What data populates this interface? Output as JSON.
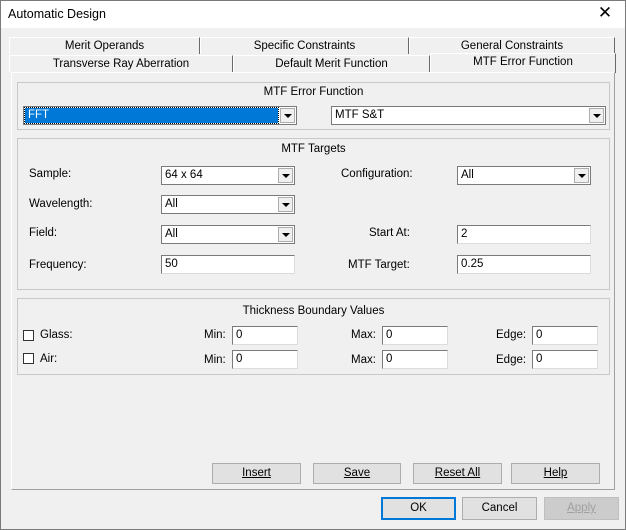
{
  "window": {
    "title": "Automatic Design"
  },
  "tabs": {
    "row1": [
      "Merit Operands",
      "Specific Constraints",
      "General Constraints"
    ],
    "row2": [
      "Transverse Ray Aberration",
      "Default Merit Function",
      "MTF Error Function"
    ]
  },
  "mtf_error_function": {
    "title": "MTF Error Function",
    "method": "FFT",
    "type": "MTF S&T"
  },
  "mtf_targets": {
    "title": "MTF Targets",
    "sample_label": "Sample:",
    "sample_value": "64 x 64",
    "wavelength_label": "Wavelength:",
    "wavelength_value": "All",
    "field_label": "Field:",
    "field_value": "All",
    "frequency_label": "Frequency:",
    "frequency_value": "50",
    "configuration_label": "Configuration:",
    "configuration_value": "All",
    "start_at_label": "Start At:",
    "start_at_value": "2",
    "mtf_target_label": "MTF Target:",
    "mtf_target_value": "0.25"
  },
  "thickness": {
    "title": "Thickness Boundary Values",
    "glass_label": "Glass:",
    "air_label": "Air:",
    "min_label": "Min:",
    "max_label": "Max:",
    "edge_label": "Edge:",
    "glass": {
      "min": "0",
      "max": "0",
      "edge": "0",
      "checked": false
    },
    "air": {
      "min": "0",
      "max": "0",
      "edge": "0",
      "checked": false
    }
  },
  "buttons": {
    "insert": "Insert",
    "save": "Save",
    "reset_all": "Reset All",
    "help": "Help",
    "ok": "OK",
    "cancel": "Cancel",
    "apply": "Apply"
  }
}
